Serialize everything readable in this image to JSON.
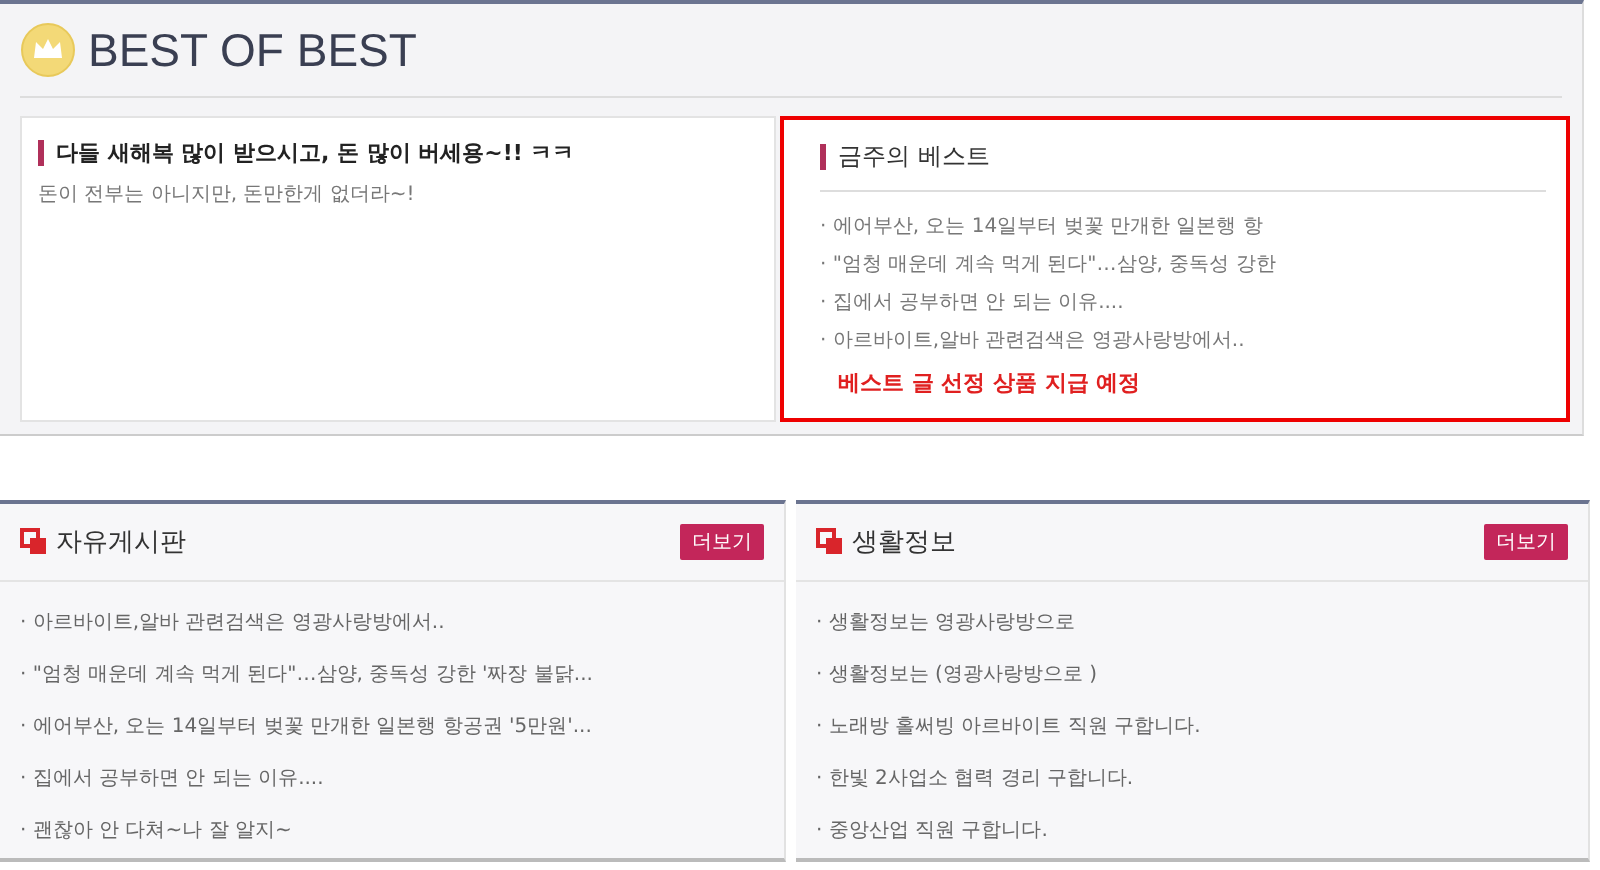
{
  "header": {
    "title": "BEST OF BEST"
  },
  "featured": {
    "title": "다들 새해복 많이 받으시고, 돈 많이 버세용~!! ㅋㅋ",
    "summary": "돈이 전부는 아니지만, 돈만한게 없더라~!"
  },
  "weekly_best": {
    "title": "금주의 베스트",
    "items": [
      "· 에어부산, 오는 14일부터 벚꽃 만개한 일본행 항",
      "· \"엄청 매운데 계속 먹게 된다\"…삼양, 중독성 강한",
      "· 집에서 공부하면 안 되는 이유....",
      "· 아르바이트,알바 관련검색은 영광사랑방에서.."
    ],
    "notice": "베스트 글 선정 상품 지급 예정"
  },
  "boards": [
    {
      "title": "자유게시판",
      "more": "더보기",
      "items": [
        "· 아르바이트,알바 관련검색은 영광사랑방에서..",
        "· \"엄청 매운데 계속 먹게 된다\"…삼양, 중독성 강한 '짜장 불닭...",
        "· 에어부산, 오는 14일부터 벚꽃 만개한 일본행 항공권 '5만원'...",
        "· 집에서 공부하면 안 되는 이유....",
        "· 괜찮아 안 다쳐~나 잘 알지~"
      ]
    },
    {
      "title": "생활정보",
      "more": "더보기",
      "items": [
        "· 생활정보는 영광사랑방으로",
        "· 생활정보는 (영광사랑방으로 )",
        "· 노래방 홀써빙 아르바이트 직원 구합니다.",
        "· 한빛 2사업소 협력 경리 구합니다.",
        "· 중앙산업 직원 구합니다."
      ]
    }
  ]
}
